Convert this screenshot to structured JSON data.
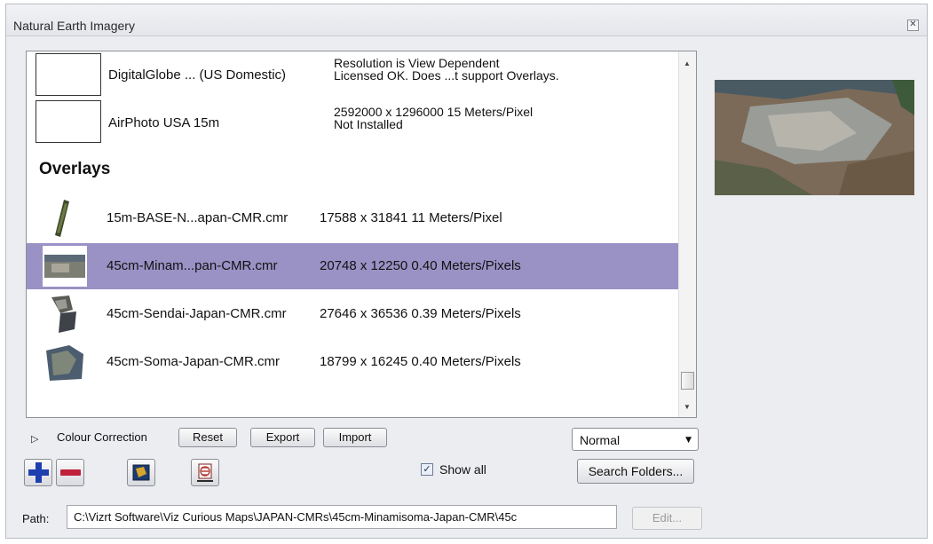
{
  "window": {
    "title": "Natural Earth Imagery",
    "close_icon": "close-icon"
  },
  "imagery_rows": [
    {
      "name": "DigitalGlobe ... (US Domestic)",
      "info_line1": "Resolution is View Dependent",
      "info_line2": "Licensed OK. Does ...t support Overlays."
    },
    {
      "name": "AirPhoto USA 15m",
      "info_line1": "2592000 x 1296000 15 Meters/Pixel",
      "info_line2": "Not Installed"
    }
  ],
  "overlays_heading": "Overlays",
  "overlays": [
    {
      "name": "15m-BASE-N...apan-CMR.cmr",
      "info": "17588 x 31841 11 Meters/Pixel",
      "selected": false
    },
    {
      "name": "45cm-Minam...pan-CMR.cmr",
      "info": "20748 x 12250  0.40 Meters/Pixels",
      "selected": true
    },
    {
      "name": "45cm-Sendai-Japan-CMR.cmr",
      "info": "27646 x 36536  0.39 Meters/Pixels",
      "selected": false
    },
    {
      "name": "45cm-Soma-Japan-CMR.cmr",
      "info": "18799 x 16245  0.40 Meters/Pixels",
      "selected": false
    }
  ],
  "colour_correction": {
    "label": "Colour Correction",
    "reset": "Reset",
    "export": "Export",
    "import": "Import"
  },
  "blend_mode": {
    "value": "Normal"
  },
  "show_all": {
    "label": "Show all",
    "checked": true
  },
  "search_folders": "Search Folders...",
  "path": {
    "label": "Path:",
    "value": "C:\\Vizrt Software\\Viz Curious Maps\\JAPAN-CMRs\\45cm-Minamisoma-Japan-CMR\\45с"
  },
  "edit": "Edit...",
  "colors": {
    "selection": "#9a92c5",
    "panel_bg": "#ecedf1",
    "add_blue": "#1f3fb0",
    "remove_red": "#c0203a"
  },
  "icons": [
    "close-icon",
    "add-icon",
    "remove-icon",
    "map-layer-icon",
    "refresh-layers-icon",
    "checkmark-icon",
    "dropdown-arrow-icon",
    "expand-triangle-icon"
  ]
}
